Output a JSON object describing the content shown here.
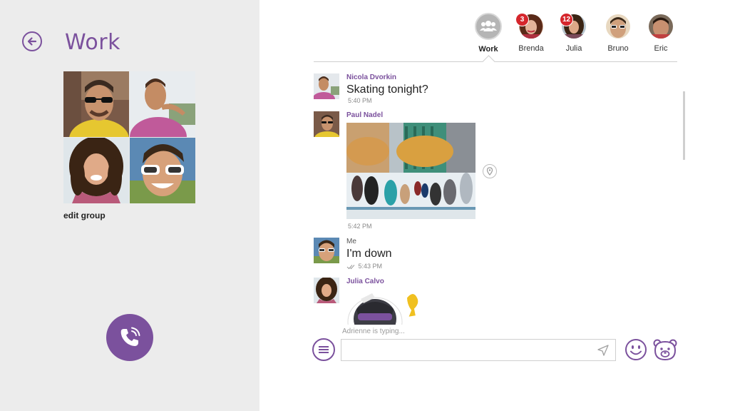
{
  "group": {
    "title": "Work",
    "edit_label": "edit group"
  },
  "contacts": [
    {
      "name": "Work",
      "active": true,
      "badge": ""
    },
    {
      "name": "Brenda",
      "active": false,
      "badge": "3"
    },
    {
      "name": "Julia",
      "active": false,
      "badge": "12"
    },
    {
      "name": "Bruno",
      "active": false,
      "badge": ""
    },
    {
      "name": "Eric",
      "active": false,
      "badge": ""
    }
  ],
  "messages": [
    {
      "sender": "Nicola Dvorkin",
      "text": "Skating tonight?",
      "time": "5:40 PM"
    },
    {
      "sender": "Paul Nadel",
      "text": "",
      "time": "5:42 PM"
    },
    {
      "sender": "Me",
      "text": "I'm down",
      "time": "5:43 PM"
    },
    {
      "sender": "Julia Calvo",
      "text": "",
      "time": ""
    }
  ],
  "composer": {
    "typing_status": "Adrienne is typing...",
    "input_value": "",
    "input_placeholder": ""
  },
  "colors": {
    "accent": "#7b519d",
    "badge": "#d5262c",
    "left_panel": "#ececec"
  },
  "icons": {
    "back": "back-arrow-icon",
    "call": "phone-call-icon",
    "menu": "hamburger-menu-icon",
    "send": "send-arrow-icon",
    "emoticon": "smiley-icon",
    "sticker": "bear-sticker-icon",
    "location": "location-pin-icon",
    "delivered": "double-check-icon"
  }
}
